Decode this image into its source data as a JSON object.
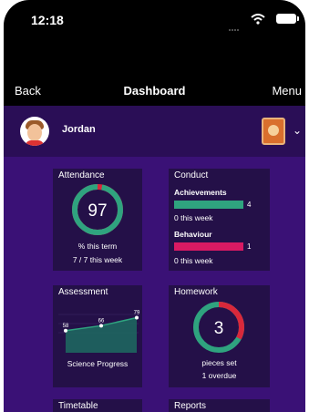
{
  "status_bar": {
    "time": "12:18"
  },
  "nav": {
    "back_label": "Back",
    "title": "Dashboard",
    "menu_label": "Menu"
  },
  "profile": {
    "name": "Jordan"
  },
  "cards": {
    "attendance": {
      "title": "Attendance",
      "percent": 97,
      "percent_label": "97",
      "caption": "% this term",
      "week": "7 / 7 this week",
      "ring_color": "#2fa37f",
      "ring_gap_color": "#d9283b"
    },
    "conduct": {
      "title": "Conduct",
      "achievements_label": "Achievements",
      "achievements_value": 4,
      "achievements_value_label": "4",
      "achievements_sub": "0 this week",
      "behaviour_label": "Behaviour",
      "behaviour_value": 1,
      "behaviour_value_label": "1",
      "behaviour_sub": "0 this week",
      "achievements_color": "#2fa37f",
      "behaviour_color": "#d91a63"
    },
    "assessment": {
      "title": "Assessment",
      "caption": "Science Progress",
      "line_color": "#2fa37f",
      "points": [
        {
          "label": "58",
          "value": 58
        },
        {
          "label": "66",
          "value": 66
        },
        {
          "label": "79",
          "value": 79
        }
      ]
    },
    "homework": {
      "title": "Homework",
      "count": 3,
      "count_label": "3",
      "caption": "pieces set",
      "overdue": "1 overdue",
      "overdue_fraction": 0.33,
      "ring_color": "#2fa37f",
      "overdue_color": "#d9283b"
    },
    "timetable": {
      "title": "Timetable"
    },
    "reports": {
      "title": "Reports"
    }
  },
  "colors": {
    "profile_bar": "#2a0e56",
    "content_bg": "#3a1176",
    "card_bg": "#241048"
  }
}
